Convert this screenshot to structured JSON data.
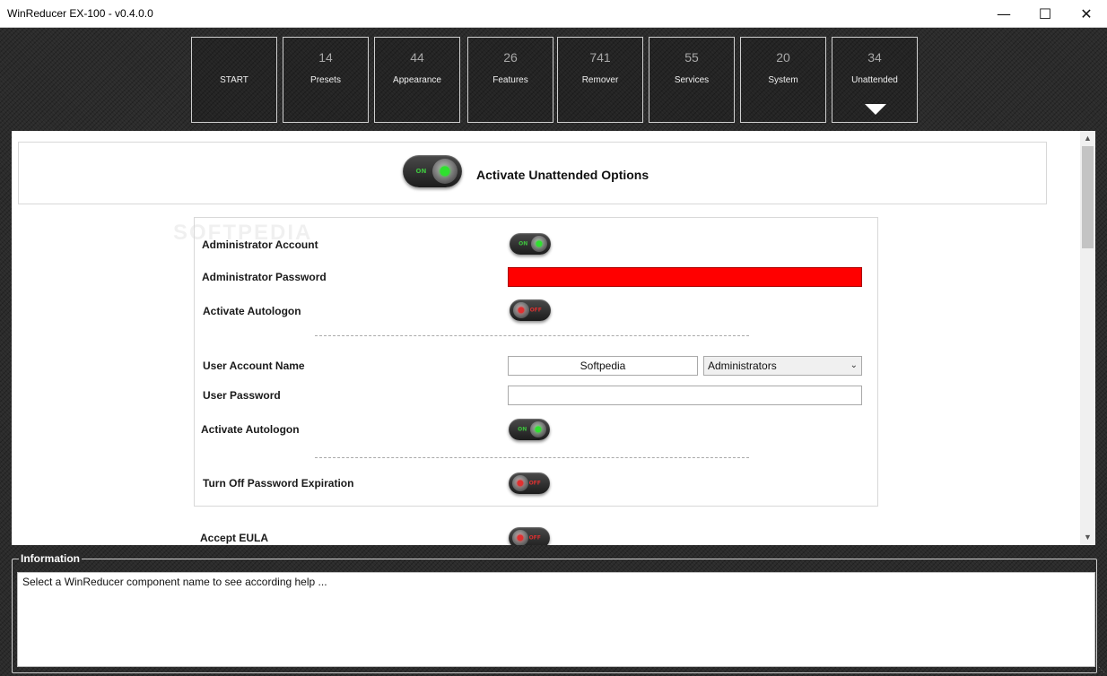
{
  "window": {
    "title": "WinReducer EX-100 - v0.4.0.0",
    "minimize_icon": "minimize-icon",
    "maximize_icon": "maximize-icon",
    "close_icon": "close-icon"
  },
  "tabs": [
    {
      "count": "",
      "label": "START"
    },
    {
      "count": "14",
      "label": "Presets"
    },
    {
      "count": "44",
      "label": "Appearance"
    },
    {
      "count": "26",
      "label": "Features"
    },
    {
      "count": "741",
      "label": "Remover"
    },
    {
      "count": "55",
      "label": "Services"
    },
    {
      "count": "20",
      "label": "System"
    },
    {
      "count": "34",
      "label": "Unattended",
      "selected": true
    }
  ],
  "activate": {
    "label": "Activate Unattended Options",
    "toggle": {
      "state": "ON"
    }
  },
  "form": {
    "admin_account": {
      "label": "Administrator Account",
      "toggle": "ON"
    },
    "admin_password": {
      "label": "Administrator Password",
      "value": ""
    },
    "admin_autologon": {
      "label": "Activate Autologon",
      "toggle": "OFF"
    },
    "user_account": {
      "label": "User Account Name",
      "value": "Softpedia",
      "group": "Administrators"
    },
    "user_password": {
      "label": "User Password",
      "value": ""
    },
    "user_autologon": {
      "label": "Activate Autologon",
      "toggle": "ON"
    },
    "password_expiration": {
      "label": "Turn Off Password Expiration",
      "toggle": "OFF"
    }
  },
  "eula": {
    "label": "Accept EULA",
    "toggle": "OFF"
  },
  "watermark": "SOFTPEDIA",
  "information": {
    "title": "Information",
    "text": "Select a WinReducer component name to see according help ..."
  },
  "colors": {
    "accent_on": "#2fe12f",
    "accent_off": "#e03030",
    "password_error": "#ff0000"
  }
}
